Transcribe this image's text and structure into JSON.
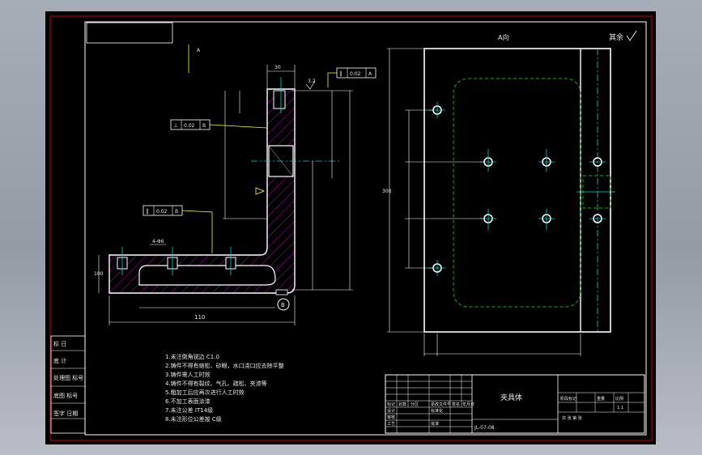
{
  "drawing": {
    "title_block": {
      "part_name": "夹具体",
      "drawing_no": "JL-07-08",
      "left_strip": [
        "标 日",
        "底 计",
        "处理图 标号",
        "底图 标号",
        "签字 日期"
      ],
      "cells": {
        "rev_header": [
          "标记",
          "处数",
          "分区",
          "更改文件号",
          "签名",
          "年月日"
        ],
        "stage_header": [
          "阶段标记",
          "重量",
          "比例"
        ],
        "design": "设计",
        "check": "审核",
        "process": "工艺",
        "approve": "批准",
        "std": "标准化",
        "sheet": "共 张 第 张",
        "scale": "1:1"
      }
    },
    "roughness_symbol": "其余",
    "view_label": "A向",
    "notes": [
      "1.未注倒角锐边 C1.0",
      "2.铸件不得有缩松、砂眼，水口浇口应去除平整",
      "3.铸件需人工时效",
      "4.铸件不得有裂纹、气孔、疏松、夹渣等",
      "5.粗加工后应再次进行人工时效",
      "6.不加工表面涂漆",
      "7.未注公差 IT14级",
      "8.未注形位公差按 C级"
    ],
    "gdt_frames": [
      {
        "symbol": "⊥",
        "value": "0.02",
        "datum": "B"
      },
      {
        "symbol": "∥",
        "value": "0.02",
        "datum": "A"
      },
      {
        "symbol": "∥",
        "value": "0.02",
        "datum": "B"
      }
    ],
    "section_labels": {
      "view_mark": "A",
      "surface": "3.2",
      "bottom_dim": "110",
      "left_dim": "100",
      "top_dim": "30",
      "hole_label": "4-Φ6",
      "datum": "B",
      "side_vertical": "300"
    }
  }
}
